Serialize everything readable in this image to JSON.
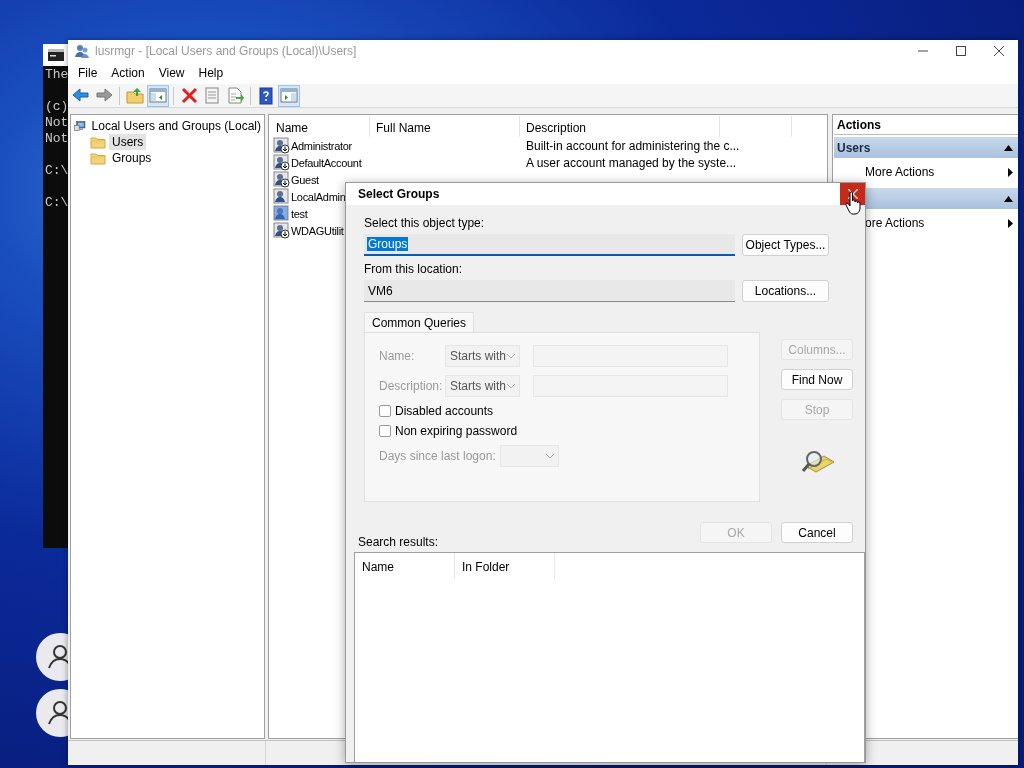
{
  "console": {
    "blocks": [
      [
        "The"
      ],
      [
        "(c)",
        "Not",
        "Not"
      ],
      [
        "C:\\"
      ],
      [
        "C:\\"
      ]
    ]
  },
  "window": {
    "title": "lusrmgr - [Local Users and Groups (Local)\\Users]",
    "active": false,
    "menu": [
      "File",
      "Action",
      "View",
      "Help"
    ],
    "toolbar": [
      {
        "kind": "back",
        "on": false
      },
      {
        "kind": "forward",
        "on": false
      },
      {
        "kind": "separator"
      },
      {
        "kind": "up",
        "on": false
      },
      {
        "kind": "tree-toggle",
        "on": true
      },
      {
        "kind": "separator"
      },
      {
        "kind": "delete",
        "on": false
      },
      {
        "kind": "properties",
        "on": false
      },
      {
        "kind": "export",
        "on": false
      },
      {
        "kind": "separator"
      },
      {
        "kind": "help",
        "on": false
      },
      {
        "kind": "pane-toggle",
        "on": true
      }
    ]
  },
  "tree": [
    {
      "label": "Local Users and Groups (Local)",
      "kind": "computer",
      "selected": false,
      "children": [
        {
          "label": "Users",
          "kind": "folder",
          "selected": true
        },
        {
          "label": "Groups",
          "kind": "folder",
          "selected": false
        }
      ]
    }
  ],
  "list": {
    "columns": [
      "Name",
      "Full Name",
      "Description"
    ],
    "rows": [
      {
        "name": "Administrator",
        "description": "Built-in account for administering the c...",
        "disabled": true,
        "selected": false
      },
      {
        "name": "DefaultAccount",
        "description": "A user account managed by the syste...",
        "disabled": true,
        "selected": false
      },
      {
        "name": "Guest",
        "disabled": true,
        "selected": false
      },
      {
        "name": "LocalAdmin",
        "disabled": false,
        "selected": false
      },
      {
        "name": "test",
        "disabled": false,
        "selected": true
      },
      {
        "name": "WDAGUtilit",
        "disabled": true,
        "selected": false
      }
    ]
  },
  "actions": {
    "title": "Actions",
    "sections": [
      {
        "header": "Users",
        "expanded": true,
        "items": [
          "More Actions"
        ]
      },
      {
        "expanded": true,
        "items": [
          "ore Actions"
        ]
      }
    ]
  },
  "dialog": {
    "title": "Select Groups",
    "object_type": {
      "label": "Select this object type:",
      "value": "Groups",
      "value_selected": true,
      "button": "Object Types..."
    },
    "location": {
      "label": "From this location:",
      "value": "VM6",
      "value_selected": false,
      "button": "Locations..."
    },
    "tabs": [
      {
        "label": "Common Queries",
        "selected": true
      }
    ],
    "queries": [
      {
        "kind": "text",
        "label": "Name:",
        "operator": "Starts with",
        "disabled": true
      },
      {
        "kind": "text",
        "label": "Description:",
        "operator": "Starts with",
        "disabled": true
      },
      {
        "kind": "checkbox",
        "label": "Disabled accounts",
        "checked": false,
        "disabled": false
      },
      {
        "kind": "checkbox",
        "label": "Non expiring password",
        "checked": false,
        "disabled": false
      },
      {
        "kind": "days",
        "label": "Days since last logon:",
        "disabled": true
      }
    ],
    "side_buttons": [
      {
        "label": "Columns...",
        "disabled": true
      },
      {
        "label": "Find Now",
        "disabled": false
      },
      {
        "label": "Stop",
        "disabled": true
      }
    ],
    "footer_buttons": [
      {
        "label": "OK",
        "disabled": true
      },
      {
        "label": "Cancel",
        "disabled": false
      }
    ],
    "results": {
      "label": "Search results:",
      "columns": [
        "Name",
        "In Folder"
      ]
    }
  }
}
